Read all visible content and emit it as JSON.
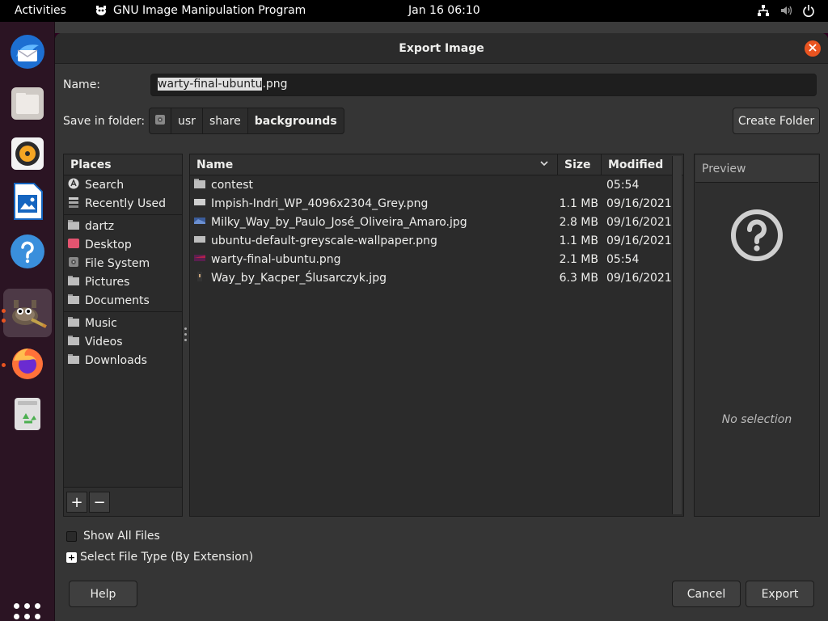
{
  "topbar": {
    "activities": "Activities",
    "app_name": "GNU Image Manipulation Program",
    "clock": "Jan 16  06:10"
  },
  "dock": {
    "items": [
      "thunderbird-icon",
      "files-icon",
      "rhythmbox-icon",
      "writer-icon",
      "help-icon",
      "gimp-icon",
      "firefox-icon",
      "trash-icon"
    ]
  },
  "dialog": {
    "title": "Export Image",
    "name_label": "Name:",
    "name_value_selected": "warty-final-ubuntu",
    "name_value_rest": ".png",
    "folder_label": "Save in folder:",
    "crumbs": [
      "usr",
      "share",
      "backgrounds"
    ],
    "create_folder": "Create Folder",
    "places": {
      "header": "Places",
      "group1": [
        "Search",
        "Recently Used"
      ],
      "group2": [
        "dartz",
        "Desktop",
        "File System",
        "Pictures",
        "Documents"
      ],
      "group3": [
        "Music",
        "Videos",
        "Downloads"
      ],
      "add": "+",
      "remove": "−"
    },
    "files": {
      "columns": {
        "name": "Name",
        "size": "Size",
        "modified": "Modified"
      },
      "rows": [
        {
          "name": "contest",
          "size": "",
          "modified": "05:54",
          "icon": "folder"
        },
        {
          "name": "Impish-Indri_WP_4096x2304_Grey.png",
          "size": "1.1 MB",
          "modified": "09/16/2021",
          "icon": "image-grey"
        },
        {
          "name": "Milky_Way_by_Paulo_José_Oliveira_Amaro.jpg",
          "size": "2.8 MB",
          "modified": "09/16/2021",
          "icon": "image-blue"
        },
        {
          "name": "ubuntu-default-greyscale-wallpaper.png",
          "size": "1.1 MB",
          "modified": "09/16/2021",
          "icon": "image-grey"
        },
        {
          "name": "warty-final-ubuntu.png",
          "size": "2.1 MB",
          "modified": "05:54",
          "icon": "image-purple"
        },
        {
          "name": "Way_by_Kacper_Ślusarczyk.jpg",
          "size": "6.3 MB",
          "modified": "09/16/2021",
          "icon": "image-dark"
        }
      ]
    },
    "preview": {
      "header": "Preview",
      "no_selection": "No selection"
    },
    "show_all_files": "Show All Files",
    "select_file_type": "Select File Type (By Extension)",
    "help": "Help",
    "cancel": "Cancel",
    "export": "Export"
  },
  "colors": {
    "accent": "#e95420",
    "dialog_bg": "#353535",
    "list_bg": "#2b2b2b"
  }
}
